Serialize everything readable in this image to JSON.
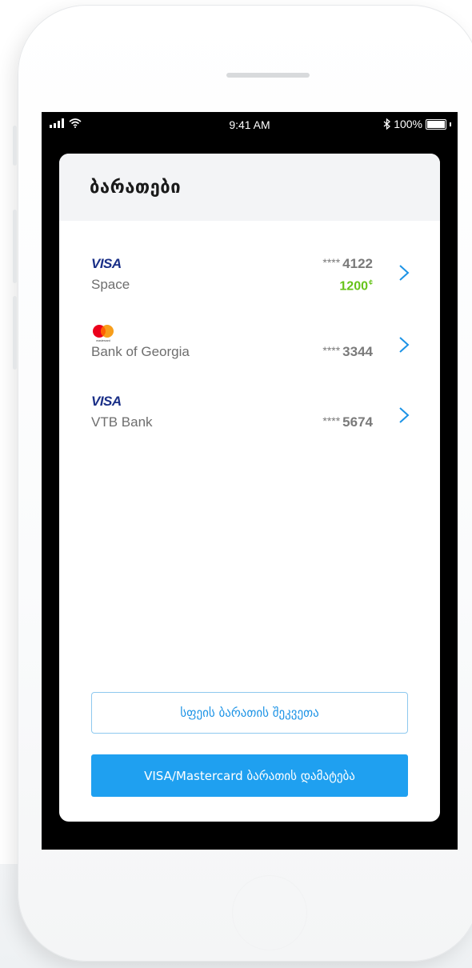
{
  "status_bar": {
    "time": "9:41 AM",
    "battery": "100%",
    "bluetooth_icon": "bluetooth-icon",
    "wifi_icon": "wifi-icon",
    "signal_icon": "signal-icon"
  },
  "screen": {
    "title": "ბარათები"
  },
  "cards": [
    {
      "brand": "VISA",
      "brand_icon": "visa-logo",
      "name": "Space",
      "stars": "****",
      "last4": "4122",
      "balance": "1200",
      "currency": "¢"
    },
    {
      "brand": "mastercard",
      "brand_icon": "mastercard-logo",
      "brand_caption": "mastercard",
      "name": "Bank of Georgia",
      "stars": "****",
      "last4": "3344"
    },
    {
      "brand": "VISA",
      "brand_icon": "visa-logo",
      "name": "VTB Bank",
      "stars": "****",
      "last4": "5674"
    }
  ],
  "buttons": {
    "order_space_card": "სფეის ბარათის შეკვეთა",
    "add_card": "VISA/Mastercard ბარათის დამატება"
  },
  "colors": {
    "accent": "#1fa0f0",
    "balance_green": "#66c31a",
    "visa_blue": "#1a2f87",
    "header_bg": "#f3f4f6"
  }
}
